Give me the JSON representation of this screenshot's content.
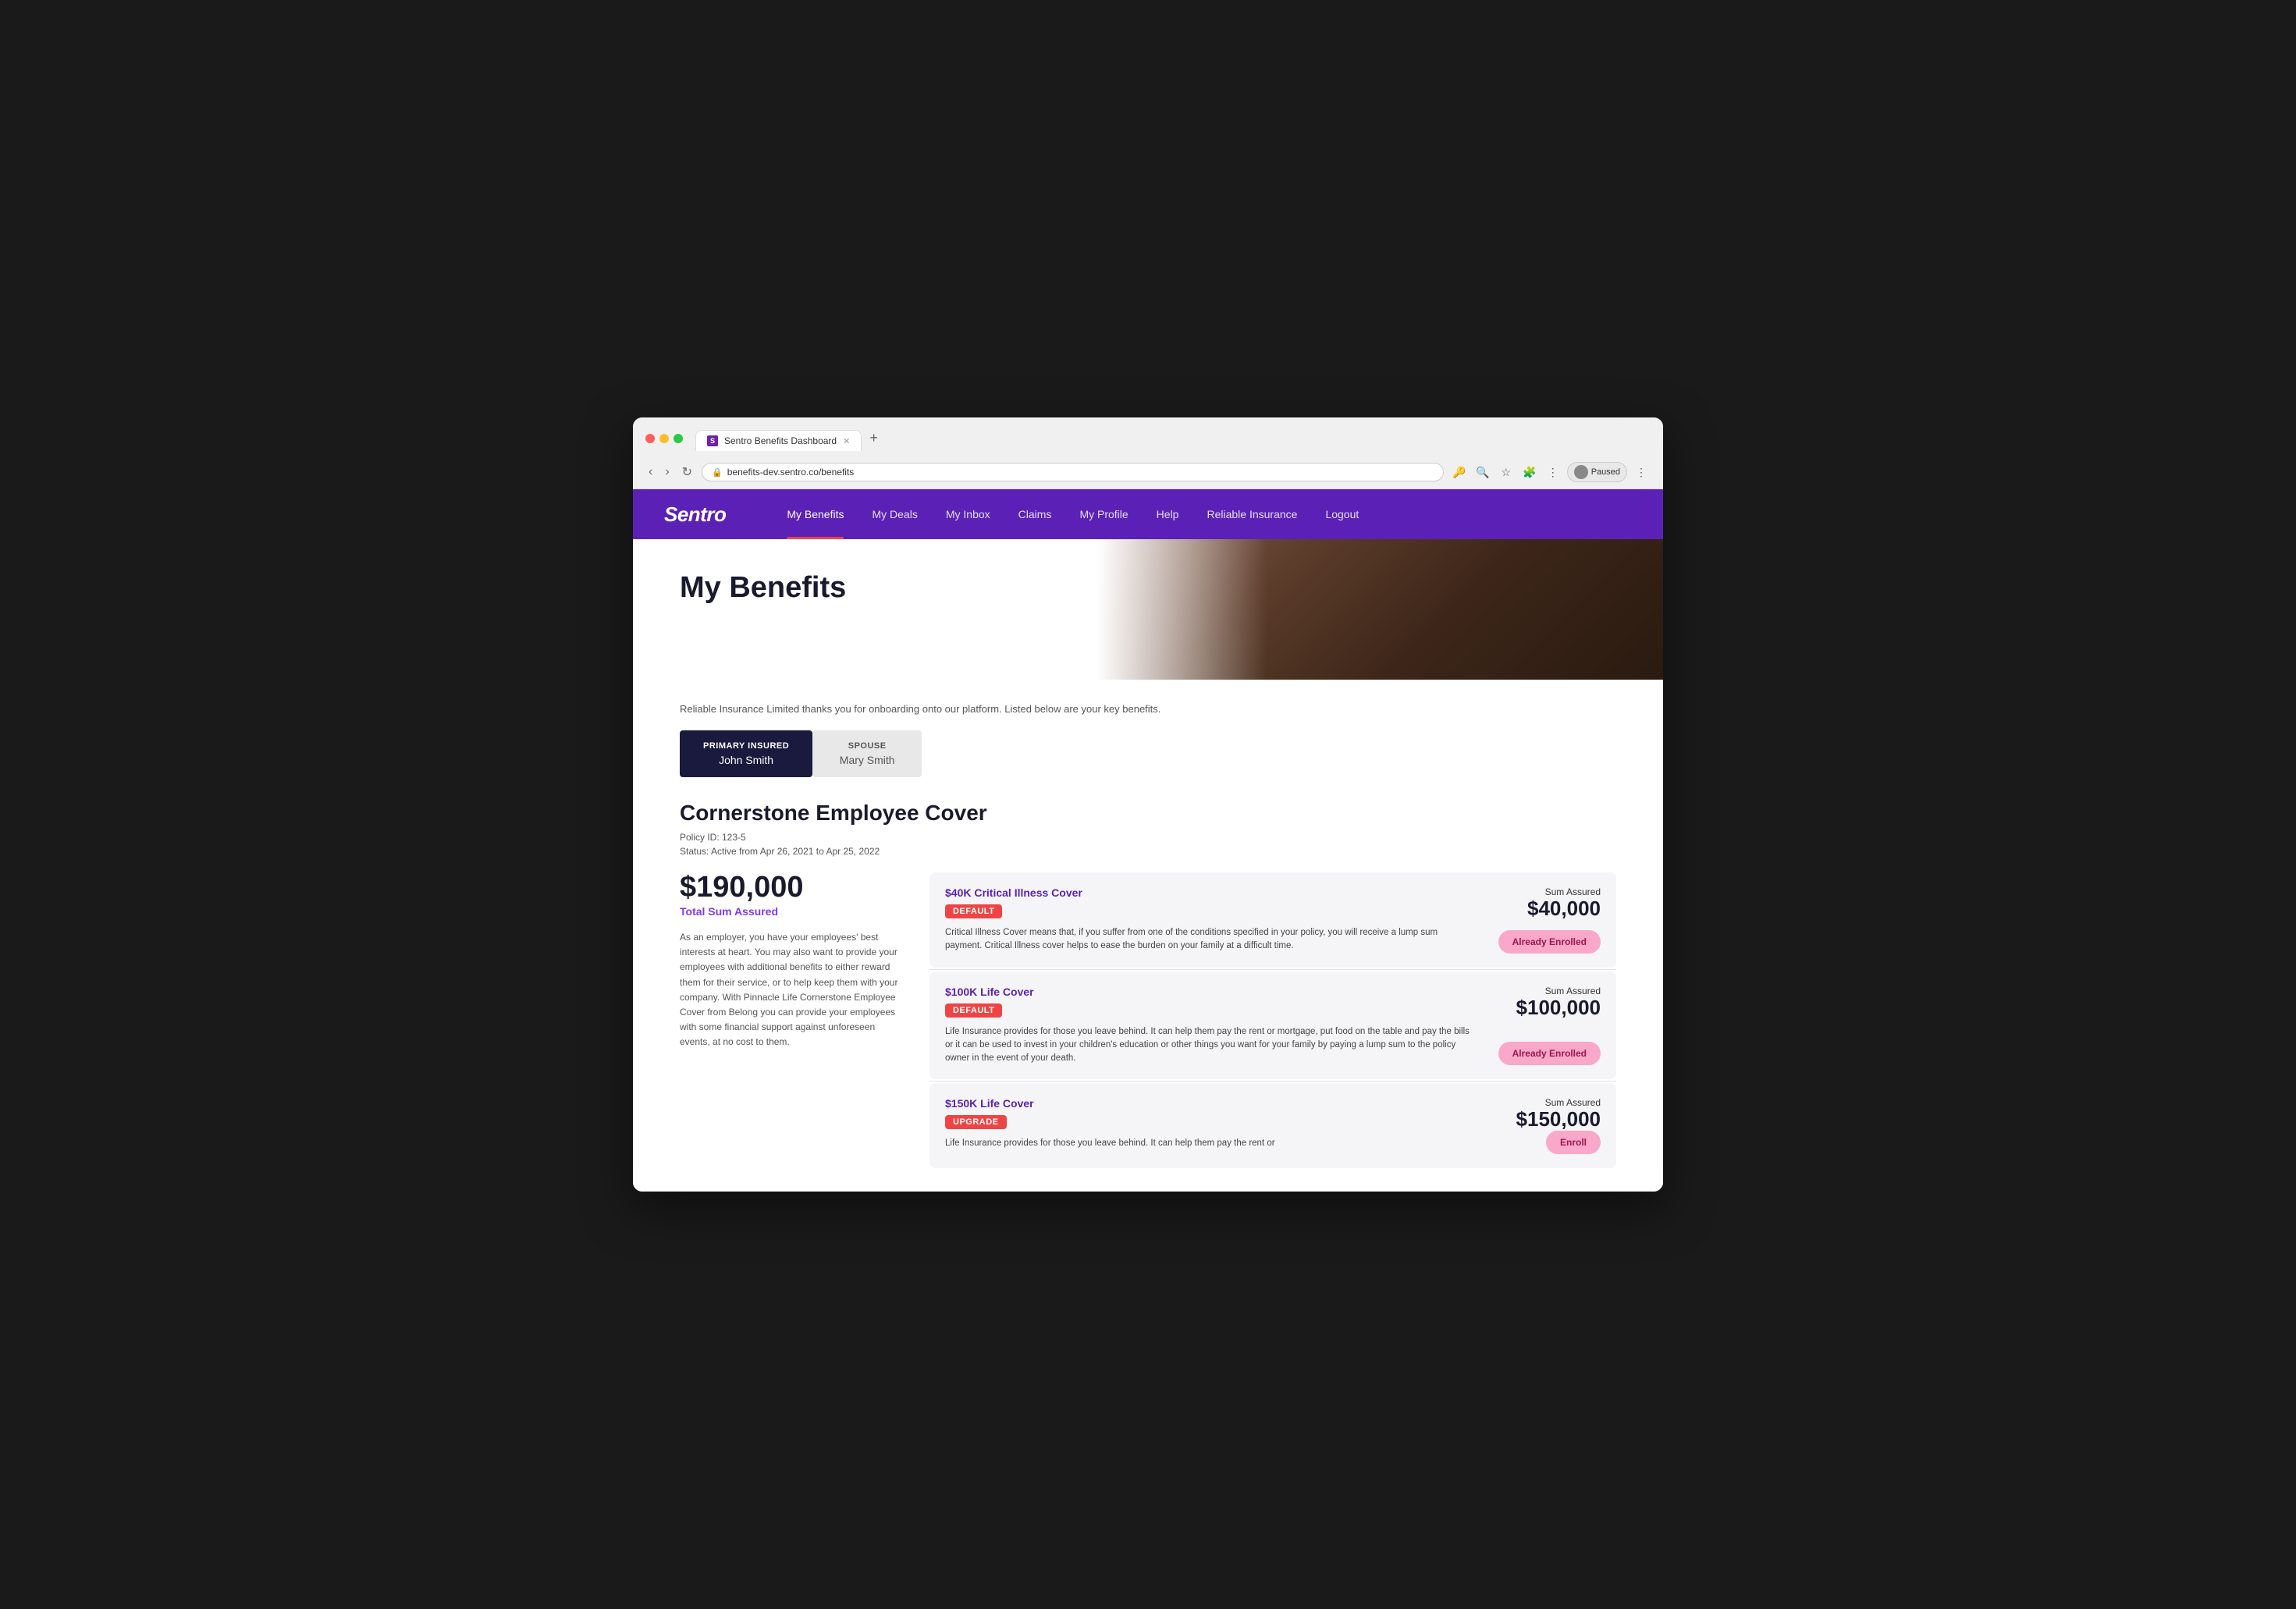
{
  "browser": {
    "url": "benefits-dev.sentro.co/benefits",
    "tab_title": "Sentro Benefits Dashboard",
    "tab_favicon": "S",
    "profile_label": "Paused"
  },
  "nav": {
    "brand": "Sentro",
    "links": [
      {
        "label": "My Benefits",
        "active": true
      },
      {
        "label": "My Deals",
        "active": false
      },
      {
        "label": "My Inbox",
        "active": false
      },
      {
        "label": "Claims",
        "active": false
      },
      {
        "label": "My Profile",
        "active": false
      },
      {
        "label": "Help",
        "active": false
      },
      {
        "label": "Reliable Insurance",
        "active": false
      },
      {
        "label": "Logout",
        "active": false
      }
    ]
  },
  "hero": {
    "title": "My Benefits"
  },
  "content": {
    "welcome_text": "Reliable Insurance Limited thanks you for onboarding onto our platform. Listed below are your key benefits.",
    "insured_tabs": [
      {
        "role": "PRIMARY INSURED",
        "name": "John Smith",
        "active": true
      },
      {
        "role": "SPOUSE",
        "name": "Mary Smith",
        "active": false
      }
    ],
    "policy": {
      "title": "Cornerstone Employee Cover",
      "id_label": "Policy ID: 123-5",
      "status_label": "Status: Active from Apr 26, 2021 to Apr 25, 2022",
      "total_sum": "$190,000",
      "total_sum_label": "Total Sum Assured",
      "description": "As an employer, you have your employees' best interests at heart. You may also want to provide your employees with additional benefits to either reward them for their service, or to help keep them with your company. With Pinnacle Life Cornerstone Employee Cover from Belong you can provide your employees with some financial support against unforeseen events, at no cost to them.",
      "covers": [
        {
          "name": "$40K Critical Illness Cover",
          "badge": "DEFAULT",
          "badge_type": "default",
          "sum_label": "Sum Assured",
          "sum_amount": "$40,000",
          "description": "Critical Illness Cover means that, if you suffer from one of the conditions specified in your policy, you will receive a lump sum payment. Critical Illness cover helps to ease the burden on your family at a difficult time.",
          "button_label": "Already Enrolled"
        },
        {
          "name": "$100K Life Cover",
          "badge": "DEFAULT",
          "badge_type": "default",
          "sum_label": "Sum Assured",
          "sum_amount": "$100,000",
          "description": "Life Insurance provides for those you leave behind. It can help them pay the rent or mortgage, put food on the table and pay the bills or it can be used to invest in your children's education or other things you want for your family by paying a lump sum to the policy owner in the event of your death.",
          "button_label": "Already Enrolled"
        },
        {
          "name": "$150K Life Cover",
          "badge": "UPGRADE",
          "badge_type": "upgrade",
          "sum_label": "Sum Assured",
          "sum_amount": "$150,000",
          "description": "Life Insurance provides for those you leave behind. It can help them pay the rent or",
          "button_label": "Enroll"
        }
      ]
    }
  }
}
